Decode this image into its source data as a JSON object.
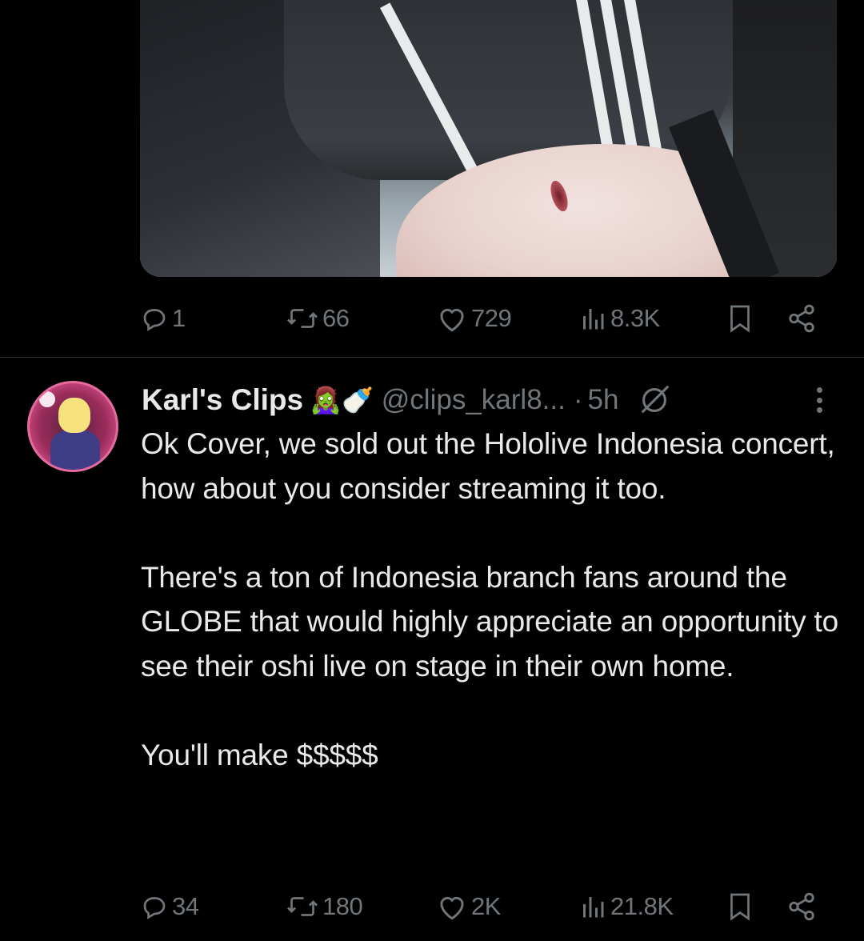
{
  "media": {
    "mute_icon": "speaker-muted-icon"
  },
  "top_tweet": {
    "stats": {
      "replies": "1",
      "reposts": "66",
      "likes": "729",
      "views": "8.3K"
    }
  },
  "tweet": {
    "author_name": "Karl's Clips",
    "author_emojis": "🧟‍♀️🍼",
    "handle": "@clips_karl8...",
    "dot": "·",
    "time": "5h",
    "text": "Ok Cover, we sold out the Hololive Indonesia concert, how about you consider streaming it too.\n\nThere's a ton of Indonesia branch fans around the GLOBE that would highly appreciate an opportunity to see their oshi live on stage in their own home.\n\nYou'll make $$$$$",
    "stats": {
      "replies": "34",
      "reposts": "180",
      "likes": "2K",
      "views": "21.8K"
    }
  },
  "colors": {
    "background": "#000000",
    "text": "#e7e9ea",
    "muted": "#71767b",
    "divider": "#2f3336"
  }
}
